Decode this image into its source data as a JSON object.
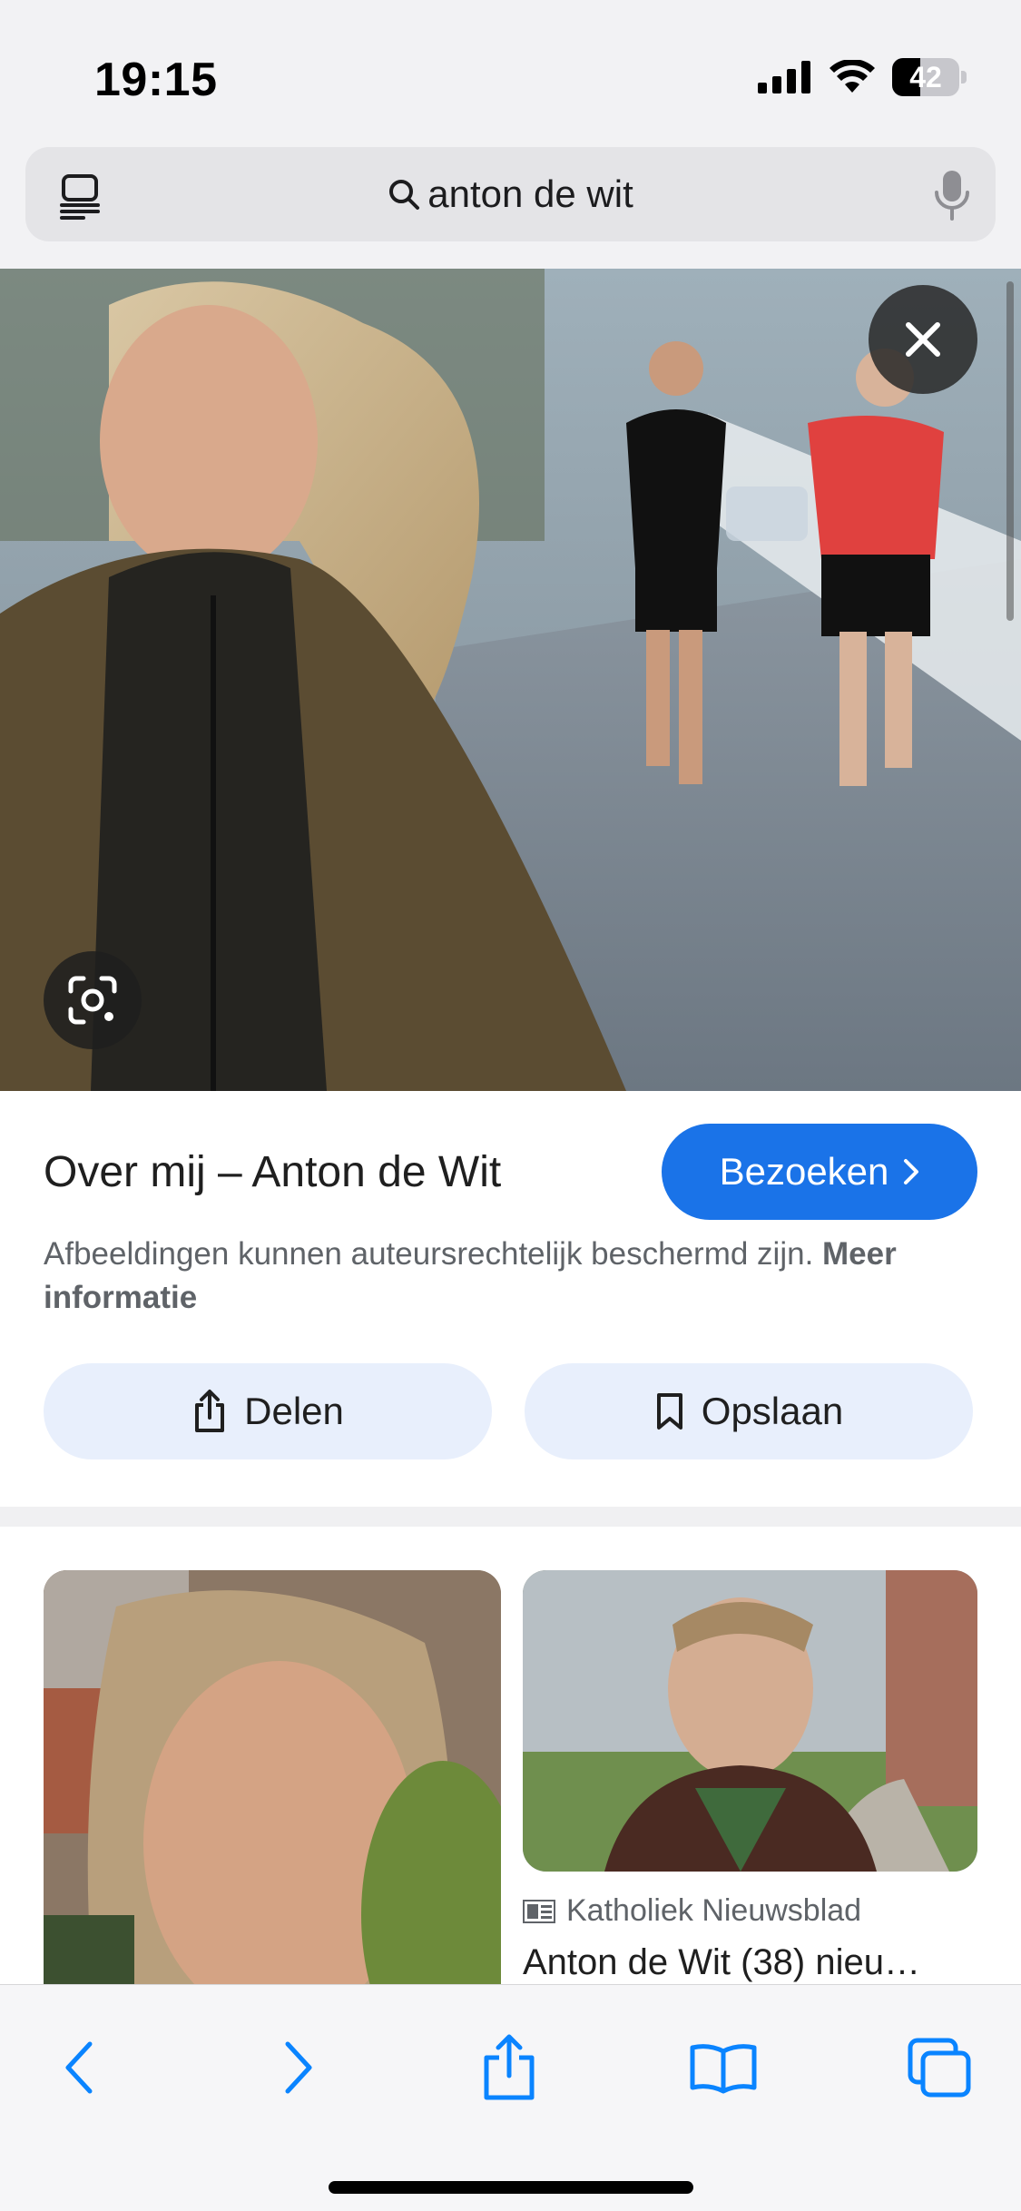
{
  "status_bar": {
    "time": "19:15",
    "battery_level": "42",
    "battery_fraction": 0.42,
    "icons": [
      "cellular-signal-icon",
      "wifi-icon",
      "battery-icon"
    ]
  },
  "browser": {
    "search_query": "anton de wit",
    "left_icon": "tab-overview-icon",
    "right_icon": "microphone-icon"
  },
  "image_viewer": {
    "close_icon": "close-icon",
    "lens_icon": "lens-icon"
  },
  "result": {
    "title": "Over mij – Anton de Wit",
    "visit_label": "Bezoeken",
    "copyright_text": "Afbeeldingen kunnen auteursrechtelijk beschermd zijn.",
    "more_info_label": "Meer informatie",
    "share_label": "Delen",
    "save_label": "Opslaan"
  },
  "related": {
    "items": [
      {
        "source": "",
        "title": ""
      },
      {
        "source": "Katholiek Nieuwsblad",
        "title": "Anton de Wit (38) nieu…"
      }
    ]
  },
  "toolbar": {
    "items": [
      "back-icon",
      "forward-icon",
      "share-icon",
      "bookmarks-icon",
      "tabs-icon"
    ]
  },
  "colors": {
    "accent": "#1a73e8",
    "action_bg": "#e8effc",
    "chrome_bg": "#f2f2f4",
    "ios_blue": "#0a84ff"
  }
}
